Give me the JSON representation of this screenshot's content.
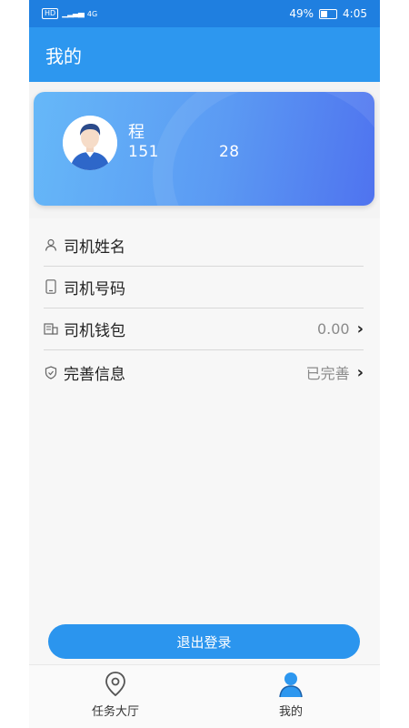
{
  "status_bar": {
    "network": "4G",
    "battery_percent": "49%",
    "time": "4:05"
  },
  "header": {
    "title": "我的"
  },
  "profile": {
    "name": "程",
    "phone_prefix": "151",
    "phone_suffix": "28"
  },
  "info_rows": [
    {
      "icon": "person-icon",
      "label": "司机姓名",
      "value": ""
    },
    {
      "icon": "phone-icon",
      "label": "司机号码",
      "value": ""
    },
    {
      "icon": "wallet-icon",
      "label": "司机钱包",
      "value": "0.00"
    },
    {
      "icon": "shield-icon",
      "label": "完善信息",
      "value": "已完善"
    }
  ],
  "logout": {
    "label": "退出登录"
  },
  "tabs": [
    {
      "icon": "location-pin-icon",
      "label": "任务大厅",
      "active": false
    },
    {
      "icon": "user-icon",
      "label": "我的",
      "active": true
    }
  ],
  "colors": {
    "primary": "#2d97ef",
    "card_gradient_start": "#66b8f8",
    "card_gradient_end": "#4f73ef"
  }
}
